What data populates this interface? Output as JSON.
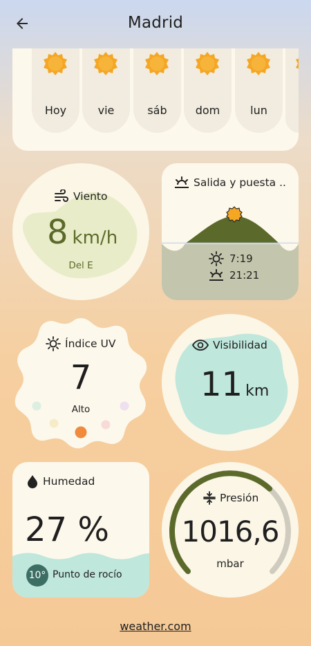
{
  "header": {
    "title": "Madrid"
  },
  "forecast": {
    "days": [
      "Hoy",
      "vie",
      "sáb",
      "dom",
      "lun"
    ]
  },
  "wind": {
    "title": "Viento",
    "value": "8",
    "unit": "km/h",
    "direction": "Del E"
  },
  "sun": {
    "title": "Salida y puesta ..",
    "sunrise": "7:19",
    "sunset": "21:21"
  },
  "uv": {
    "title": "Índice UV",
    "value": "7",
    "level": "Alto"
  },
  "visibility": {
    "title": "Visibilidad",
    "value": "11",
    "unit": "km"
  },
  "humidity": {
    "title": "Humedad",
    "value": "27 %",
    "dew_point": "10°",
    "dew_label": "Punto de rocío"
  },
  "pressure": {
    "title": "Presión",
    "value": "1016,6",
    "unit": "mbar",
    "level": 0.66
  },
  "footer": {
    "link": "weather.com"
  },
  "colors": {
    "sun": "#f5a623",
    "olive": "#5b6a2a",
    "mint": "#bfe7dc",
    "uv_marker": "#f08a3c",
    "accent_dark": "#3d6e63"
  }
}
